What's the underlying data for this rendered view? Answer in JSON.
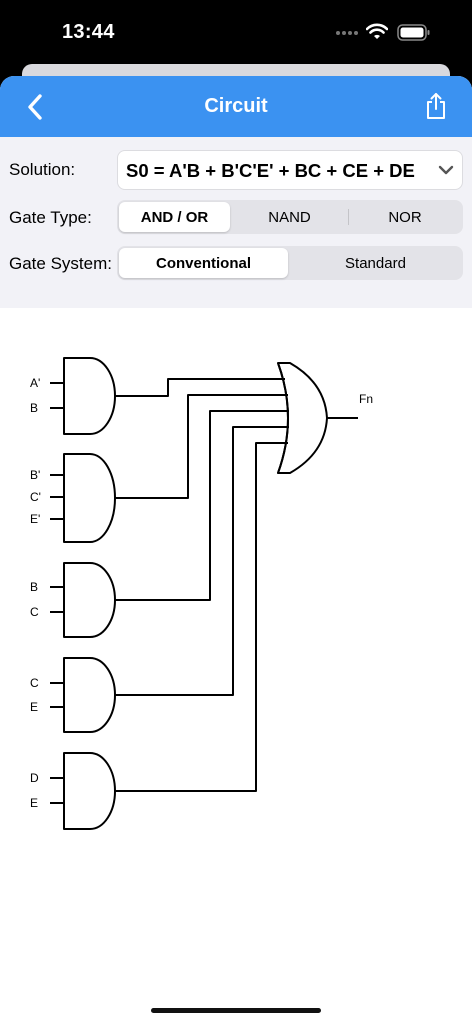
{
  "status_bar": {
    "time": "13:44"
  },
  "header": {
    "title": "Circuit"
  },
  "controls": {
    "solution_label": "Solution:",
    "solution_value": "S0 = A'B + B'C'E' + BC + CE + DE",
    "gate_type_label": "Gate Type:",
    "gate_type_options": [
      "AND / OR",
      "NAND",
      "NOR"
    ],
    "gate_type_selected": "AND / OR",
    "gate_system_label": "Gate System:",
    "gate_system_options": [
      "Conventional",
      "Standard"
    ],
    "gate_system_selected": "Conventional"
  },
  "circuit": {
    "and_gates": [
      {
        "inputs": [
          "A'",
          "B"
        ]
      },
      {
        "inputs": [
          "B'",
          "C'",
          "E'"
        ]
      },
      {
        "inputs": [
          "B",
          "C"
        ]
      },
      {
        "inputs": [
          "C",
          "E"
        ]
      },
      {
        "inputs": [
          "D",
          "E"
        ]
      }
    ],
    "output_label": "Fn"
  },
  "colors": {
    "accent": "#3b92f1",
    "controls_bg": "#f2f2f7"
  },
  "icons": {
    "back": "chevron-left-icon",
    "share": "share-icon",
    "dropdown": "chevron-down-icon"
  }
}
